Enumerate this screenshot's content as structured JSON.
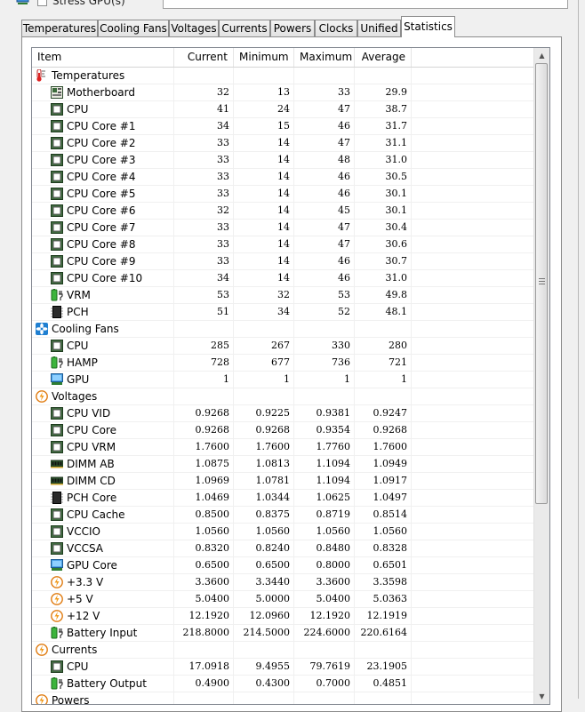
{
  "top": {
    "stress_label": "Stress GPU(s)"
  },
  "tabs": [
    {
      "label": "Temperatures",
      "active": false
    },
    {
      "label": "Cooling Fans",
      "active": false
    },
    {
      "label": "Voltages",
      "active": false
    },
    {
      "label": "Currents",
      "active": false
    },
    {
      "label": "Powers",
      "active": false
    },
    {
      "label": "Clocks",
      "active": false
    },
    {
      "label": "Unified",
      "active": false
    },
    {
      "label": "Statistics",
      "active": true
    }
  ],
  "columns": [
    "Item",
    "Current",
    "Minimum",
    "Maximum",
    "Average"
  ],
  "rows": [
    {
      "kind": "group",
      "icon": "thermometer-icon",
      "name": "Temperatures"
    },
    {
      "kind": "item",
      "icon": "motherboard-icon",
      "name": "Motherboard",
      "values": [
        "32",
        "13",
        "33",
        "29.9"
      ]
    },
    {
      "kind": "item",
      "icon": "chip-icon",
      "name": "CPU",
      "values": [
        "41",
        "24",
        "47",
        "38.7"
      ]
    },
    {
      "kind": "item",
      "icon": "chip-icon",
      "name": "CPU Core #1",
      "values": [
        "34",
        "15",
        "46",
        "31.7"
      ]
    },
    {
      "kind": "item",
      "icon": "chip-icon",
      "name": "CPU Core #2",
      "values": [
        "33",
        "14",
        "47",
        "31.1"
      ]
    },
    {
      "kind": "item",
      "icon": "chip-icon",
      "name": "CPU Core #3",
      "values": [
        "33",
        "14",
        "48",
        "31.0"
      ]
    },
    {
      "kind": "item",
      "icon": "chip-icon",
      "name": "CPU Core #4",
      "values": [
        "33",
        "14",
        "46",
        "30.5"
      ]
    },
    {
      "kind": "item",
      "icon": "chip-icon",
      "name": "CPU Core #5",
      "values": [
        "33",
        "14",
        "46",
        "30.1"
      ]
    },
    {
      "kind": "item",
      "icon": "chip-icon",
      "name": "CPU Core #6",
      "values": [
        "32",
        "14",
        "45",
        "30.1"
      ]
    },
    {
      "kind": "item",
      "icon": "chip-icon",
      "name": "CPU Core #7",
      "values": [
        "33",
        "14",
        "47",
        "30.4"
      ]
    },
    {
      "kind": "item",
      "icon": "chip-icon",
      "name": "CPU Core #8",
      "values": [
        "33",
        "14",
        "47",
        "30.6"
      ]
    },
    {
      "kind": "item",
      "icon": "chip-icon",
      "name": "CPU Core #9",
      "values": [
        "33",
        "14",
        "46",
        "30.7"
      ]
    },
    {
      "kind": "item",
      "icon": "chip-icon",
      "name": "CPU Core #10",
      "values": [
        "34",
        "14",
        "46",
        "31.0"
      ]
    },
    {
      "kind": "item",
      "icon": "battery-icon",
      "name": "VRM",
      "values": [
        "53",
        "32",
        "53",
        "49.8"
      ]
    },
    {
      "kind": "item",
      "icon": "pch-chip-icon",
      "name": "PCH",
      "values": [
        "51",
        "34",
        "52",
        "48.1"
      ]
    },
    {
      "kind": "group",
      "icon": "fan-icon",
      "name": "Cooling Fans"
    },
    {
      "kind": "item",
      "icon": "chip-icon",
      "name": "CPU",
      "values": [
        "285",
        "267",
        "330",
        "280"
      ]
    },
    {
      "kind": "item",
      "icon": "battery-icon",
      "name": "HAMP",
      "values": [
        "728",
        "677",
        "736",
        "721"
      ]
    },
    {
      "kind": "item",
      "icon": "gpu-icon",
      "name": "GPU",
      "values": [
        "1",
        "1",
        "1",
        "1"
      ]
    },
    {
      "kind": "group",
      "icon": "voltage-icon",
      "name": "Voltages"
    },
    {
      "kind": "item",
      "icon": "chip-icon",
      "name": "CPU VID",
      "values": [
        "0.9268",
        "0.9225",
        "0.9381",
        "0.9247"
      ]
    },
    {
      "kind": "item",
      "icon": "chip-icon",
      "name": "CPU Core",
      "values": [
        "0.9268",
        "0.9268",
        "0.9354",
        "0.9268"
      ]
    },
    {
      "kind": "item",
      "icon": "chip-icon",
      "name": "CPU VRM",
      "values": [
        "1.7600",
        "1.7600",
        "1.7760",
        "1.7600"
      ]
    },
    {
      "kind": "item",
      "icon": "memory-icon",
      "name": "DIMM AB",
      "values": [
        "1.0875",
        "1.0813",
        "1.1094",
        "1.0949"
      ]
    },
    {
      "kind": "item",
      "icon": "memory-icon",
      "name": "DIMM CD",
      "values": [
        "1.0969",
        "1.0781",
        "1.1094",
        "1.0917"
      ]
    },
    {
      "kind": "item",
      "icon": "pch-chip-icon",
      "name": "PCH Core",
      "values": [
        "1.0469",
        "1.0344",
        "1.0625",
        "1.0497"
      ]
    },
    {
      "kind": "item",
      "icon": "chip-icon",
      "name": "CPU Cache",
      "values": [
        "0.8500",
        "0.8375",
        "0.8719",
        "0.8514"
      ]
    },
    {
      "kind": "item",
      "icon": "chip-icon",
      "name": "VCCIO",
      "values": [
        "1.0560",
        "1.0560",
        "1.0560",
        "1.0560"
      ]
    },
    {
      "kind": "item",
      "icon": "chip-icon",
      "name": "VCCSA",
      "values": [
        "0.8320",
        "0.8240",
        "0.8480",
        "0.8328"
      ]
    },
    {
      "kind": "item",
      "icon": "gpu-icon",
      "name": "GPU Core",
      "values": [
        "0.6500",
        "0.6500",
        "0.8000",
        "0.6501"
      ]
    },
    {
      "kind": "item",
      "icon": "voltage-icon",
      "name": "+3.3 V",
      "values": [
        "3.3600",
        "3.3440",
        "3.3600",
        "3.3598"
      ]
    },
    {
      "kind": "item",
      "icon": "voltage-icon",
      "name": "+5 V",
      "values": [
        "5.0400",
        "5.0000",
        "5.0400",
        "5.0363"
      ]
    },
    {
      "kind": "item",
      "icon": "voltage-icon",
      "name": "+12 V",
      "values": [
        "12.1920",
        "12.0960",
        "12.1920",
        "12.1919"
      ]
    },
    {
      "kind": "item",
      "icon": "battery-icon",
      "name": "Battery Input",
      "values": [
        "218.8000",
        "214.5000",
        "224.6000",
        "220.6164"
      ]
    },
    {
      "kind": "group",
      "icon": "voltage-icon",
      "name": "Currents"
    },
    {
      "kind": "item",
      "icon": "chip-icon",
      "name": "CPU",
      "values": [
        "17.0918",
        "9.4955",
        "79.7619",
        "23.1905"
      ]
    },
    {
      "kind": "item",
      "icon": "battery-icon",
      "name": "Battery Output",
      "values": [
        "0.4900",
        "0.4300",
        "0.7000",
        "0.4851"
      ]
    },
    {
      "kind": "group",
      "icon": "voltage-icon",
      "name": "Powers"
    }
  ],
  "scrollbar": {
    "up_icon": "arrow-up-icon",
    "down_icon": "arrow-down-icon"
  }
}
